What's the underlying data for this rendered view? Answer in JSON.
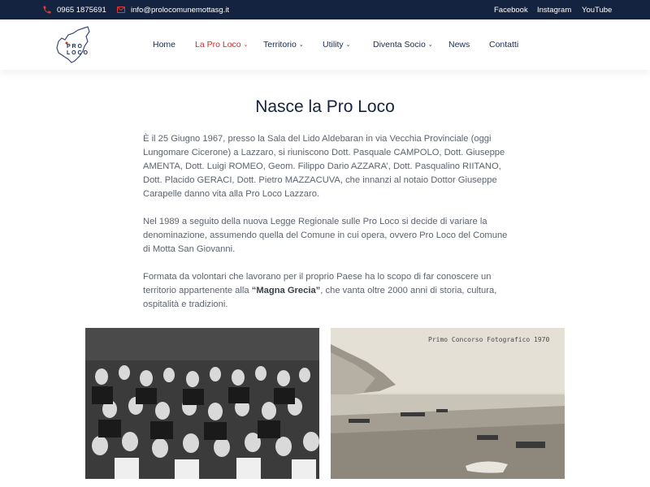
{
  "topbar": {
    "phone": "0965 1875691",
    "email": "info@prolocomunemottasg.it",
    "social": [
      "Facebook",
      "Instagram",
      "YouTube"
    ],
    "icons": [
      "phone-icon",
      "mail-icon"
    ],
    "bg_color": "#14233f",
    "accent_color": "#e23a3a"
  },
  "header": {
    "logo_text": [
      "P R O",
      "L O C O"
    ],
    "nav": [
      {
        "label": "Home",
        "dropdown": false,
        "active": false
      },
      {
        "label": "La Pro Loco",
        "dropdown": true,
        "active": true
      },
      {
        "label": "Territorio",
        "dropdown": true,
        "active": false
      },
      {
        "label": "Utility",
        "dropdown": true,
        "active": false
      },
      {
        "label": "Diventa Socio",
        "dropdown": true,
        "active": false
      },
      {
        "label": "News",
        "dropdown": false,
        "active": false
      },
      {
        "label": "Contatti",
        "dropdown": false,
        "active": false
      }
    ],
    "chevron": "⌄"
  },
  "main": {
    "title": "Nasce la Pro Loco",
    "paragraphs": [
      "È il 25 Giugno 1967, presso la Sala del Lido Aldebaran in via Vecchia Provinciale (oggi Lungomare Cicerone) a Lazzaro, si riuniscono Dott. Pasquale CAMPOLO, Dott. Giuseppe AMENTA, Dott. Luigi ROMEO, Geom. Filippo Dario AZZARA’, Dott. Pasqualino RIITANO, Dott. Placido GERACI, Dott. Pietro MAZZACUVA, che innanzi al notaio Dottor Giuseppe Carapelle danno vita alla Pro Loco Lazzaro.",
      "Nel 1989 a seguito della nuova Legge Regionale sulle Pro Loco si decide di variare la denominazione, assumendo quella del Comune in cui opera, ovvero Pro Loco del Comune di Motta San Giovanni."
    ],
    "para3": {
      "before": "Formata da volontari che lavorano per il proprio Paese ha lo scopo di far conoscere un territorio appartenente alla ",
      "bold": "“Magna Grecia”",
      "after": ", che vanta oltre 2000 anni di storia, cultura, ospitalità e tradizioni."
    },
    "photos": {
      "right_caption": "Primo Concorso Fotografico 1970"
    }
  }
}
